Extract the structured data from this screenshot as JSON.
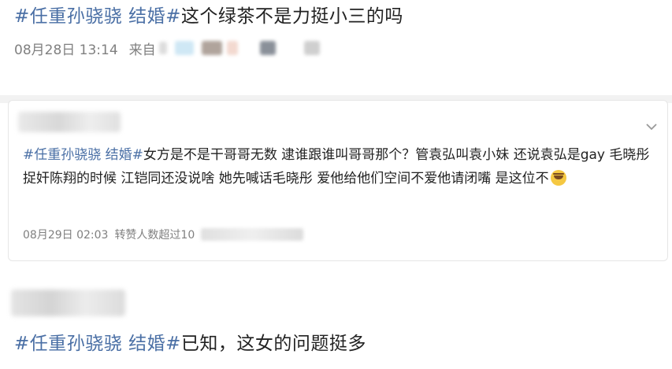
{
  "post1": {
    "hashtag": "#任重孙骁骁 结婚#",
    "text": "这个绿茶不是力挺小三的吗",
    "date": "08月28日 13:14",
    "source_prefix": "来自"
  },
  "comment": {
    "hashtag": "#任重孙骁骁 结婚#",
    "text": "女方是不是干哥哥无数 逮谁跟谁叫哥哥那个？管袁弘叫袁小妹 还说袁弘是gay 毛晓彤捉奸陈翔的时候 江铠同还没说啥 她先喊话毛晓彤 爱他给他们空间不爱他请闭嘴 是这位不",
    "emoji": "crying-face-icon",
    "date": "08月29日 02:03",
    "reposts": "转赞人数超过10"
  },
  "post3": {
    "hashtag": "#任重孙骁骁 结婚#",
    "text": "已知，这女的问题挺多"
  },
  "colors": {
    "hashtag": "#4a6fa5",
    "meta": "#808080",
    "divider": "#f2f2f2"
  }
}
